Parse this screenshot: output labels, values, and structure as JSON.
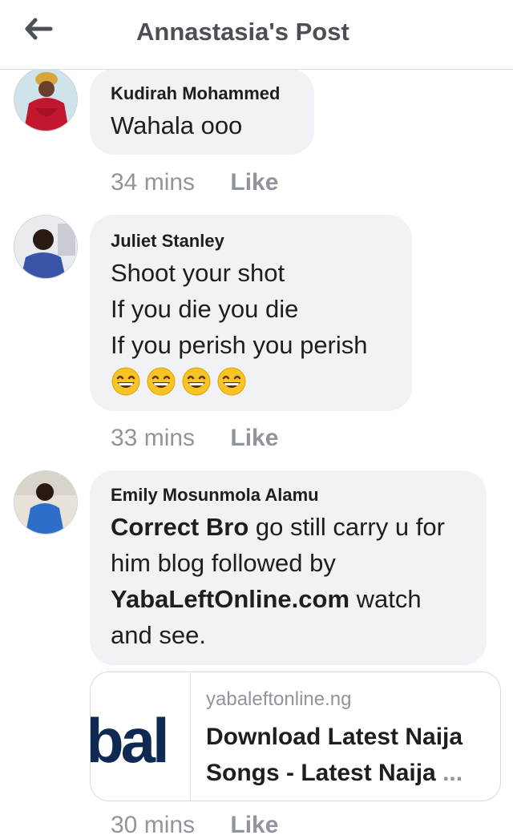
{
  "header": {
    "title": "Annastasia's Post"
  },
  "comments": [
    {
      "author": "Kudirah Mohammed",
      "lines": [
        "Wahala ooo"
      ],
      "time": "34 mins",
      "like_label": "Like"
    },
    {
      "author": "Juliet Stanley",
      "lines": [
        "Shoot your shot",
        "If you die you die",
        "If you perish you perish"
      ],
      "emoji_count": 4,
      "time": "33 mins",
      "like_label": "Like"
    },
    {
      "author": "Emily Mosunmola Alamu",
      "bold1": "Correct Bro",
      "text1": " go still carry u for",
      "text2": "him blog followed by",
      "bold2": "YabaLeftOnline.com",
      "text3": " watch",
      "text4": "and see.",
      "time": "30 mins",
      "like_label": "Like"
    }
  ],
  "link_preview": {
    "thumb_text": "bal",
    "domain": "yabaleftonline.ng",
    "title_line1": "Download Latest Naija",
    "title_line2": "Songs - Latest Naija",
    "ellipsis": "..."
  },
  "colors": {
    "bubble_bg": "#f0f2f5",
    "meta": "#90949c",
    "title": "#4b4f56",
    "text": "#1c1e21"
  }
}
